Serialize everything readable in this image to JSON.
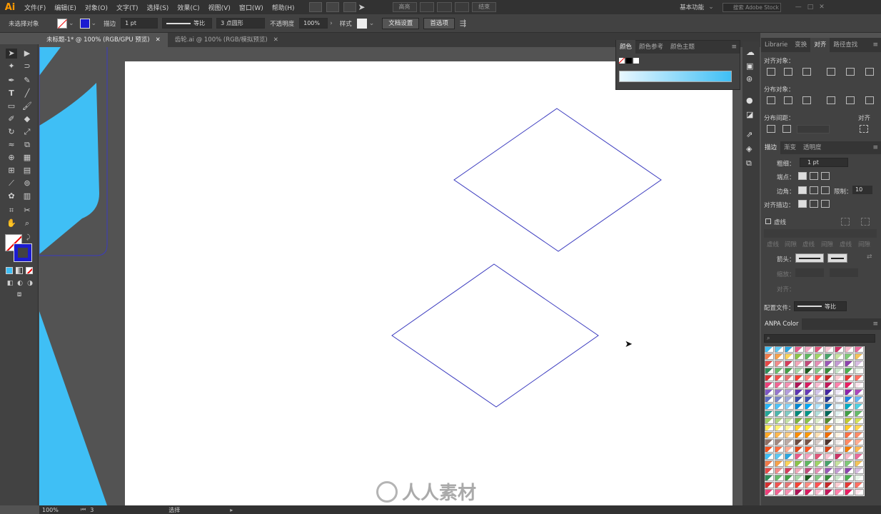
{
  "app": {
    "logo": "Ai"
  },
  "menu": [
    "文件(F)",
    "编辑(E)",
    "对象(O)",
    "文字(T)",
    "选择(S)",
    "效果(C)",
    "视图(V)",
    "窗口(W)",
    "帮助(H)"
  ],
  "menubar_right": {
    "workspace": "基本功能",
    "search_placeholder": "搜索 Adobe Stock",
    "segments": [
      "高亮",
      "",
      "",
      "",
      "结束"
    ]
  },
  "controlbar": {
    "selection": "未选择对象",
    "stroke_label": "描边",
    "stroke_weight": "1 pt",
    "stroke_profile": "等比",
    "brush": "3 点圆形",
    "opacity_label": "不透明度",
    "opacity": "100%",
    "style_label": "样式",
    "doc_setup": "文档设置",
    "prefs": "首选项"
  },
  "tabs": [
    {
      "label": "未标题-1* @ 100% (RGB/GPU 预览)",
      "active": true
    },
    {
      "label": "齿轮.ai @ 100% (RGB/模拟预览)",
      "active": false
    }
  ],
  "color_panel": {
    "tabs": [
      "颜色",
      "颜色参考",
      "颜色主题"
    ]
  },
  "right_panel": {
    "top_tabs": [
      "Librarie",
      "变换",
      "对齐",
      "路径查找"
    ],
    "align_objects": "对齐对象：",
    "distribute_objects": "分布对象：",
    "distribute_spacing": "分布间距：",
    "align_to": "对齐",
    "stroke_tabs": [
      "描边",
      "渐变",
      "透明度"
    ],
    "weight_label": "粗细：",
    "weight_value": "1 pt",
    "cap_label": "端点：",
    "corner_label": "边角：",
    "limit_label": "限制：",
    "limit_value": "10",
    "align_stroke_label": "对齐描边：",
    "dashed_label": "虚线",
    "dash_cols": [
      "虚线",
      "间隙",
      "虚线",
      "间隙",
      "虚线",
      "间隙"
    ],
    "arrow_label": "箭头：",
    "scale_label": "缩放：",
    "align_label": "对齐：",
    "profile_label": "配置文件：",
    "profile_value": "等比",
    "anpa_title": "ANPA Color"
  },
  "status": {
    "zoom": "100%",
    "page": "3",
    "mode": "选择"
  },
  "watermark": "人人素材",
  "colors": {
    "accent_blue": "#3fbff5",
    "path_stroke": "#3b3bbf",
    "orange": "#ff9a00"
  }
}
